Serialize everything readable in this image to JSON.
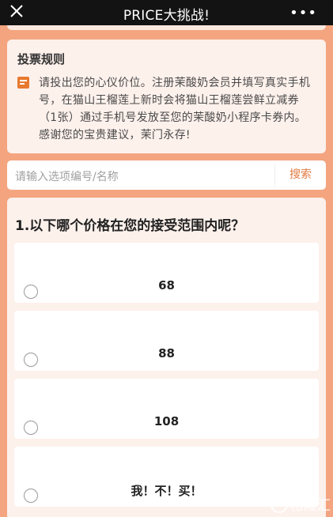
{
  "topbar": {
    "title": "PRICE大挑战!",
    "close_icon": "close-icon",
    "more_label": "•••"
  },
  "rules": {
    "title": "投票规则",
    "icon": "rules-doc-icon",
    "text": "请投出您的心仪价位。注册茉酸奶会员并填写真实手机号，在猫山王榴莲上新时会将猫山王榴莲尝鲜立减券（1张）通过手机号发放至您的茉酸奶小程序卡券内。感谢您的宝贵建议，茉门永存!"
  },
  "search": {
    "placeholder": "请输入选项编号/名称",
    "button_label": "搜索"
  },
  "question": {
    "title": "1.以下哪个价格在您的接受范围内呢？",
    "options": [
      {
        "label": "68"
      },
      {
        "label": "88"
      },
      {
        "label": "108"
      },
      {
        "label": "我！不！买！"
      }
    ]
  },
  "colors": {
    "background": "#f4a57f",
    "topbar": "#131313",
    "accent": "#e17b43",
    "card": "#fdf1ec"
  },
  "watermark": {
    "logo": "G",
    "text": "格隆汇"
  }
}
